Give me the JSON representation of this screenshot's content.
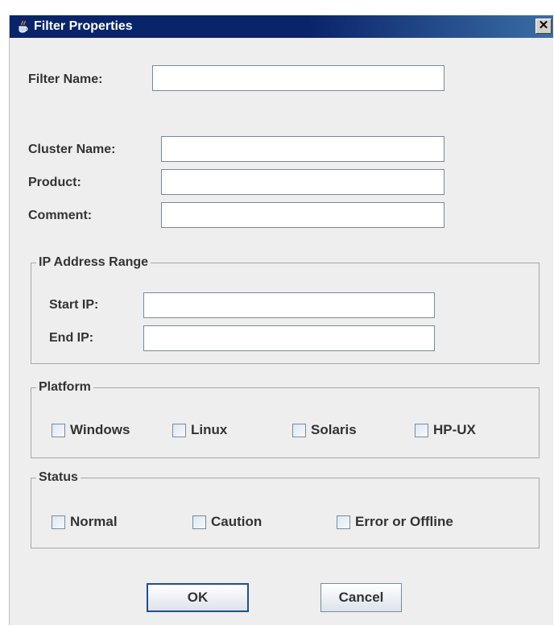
{
  "window": {
    "title": "Filter Properties",
    "close_label": "✕"
  },
  "form": {
    "filter_name": {
      "label": "Filter Name:",
      "value": ""
    },
    "cluster_name": {
      "label": "Cluster Name:",
      "value": ""
    },
    "product": {
      "label": "Product:",
      "value": ""
    },
    "comment": {
      "label": "Comment:",
      "value": ""
    }
  },
  "ip_range": {
    "legend": "IP Address Range",
    "start_ip": {
      "label": "Start IP:",
      "value": ""
    },
    "end_ip": {
      "label": "End IP:",
      "value": ""
    }
  },
  "platform": {
    "legend": "Platform",
    "options": [
      {
        "label": "Windows",
        "checked": false
      },
      {
        "label": "Linux",
        "checked": false
      },
      {
        "label": "Solaris",
        "checked": false
      },
      {
        "label": "HP-UX",
        "checked": false
      }
    ]
  },
  "status": {
    "legend": "Status",
    "options": [
      {
        "label": "Normal",
        "checked": false
      },
      {
        "label": "Caution",
        "checked": false
      },
      {
        "label": "Error or Offline",
        "checked": false
      }
    ]
  },
  "buttons": {
    "ok_label": "OK",
    "cancel_label": "Cancel"
  },
  "colors": {
    "titlebar": "#0a246a",
    "dialog_background": "#eeeeee",
    "field_border": "#7a8a99"
  },
  "icons": {
    "title_icon": "java-cup-icon",
    "close_icon": "close-icon"
  }
}
